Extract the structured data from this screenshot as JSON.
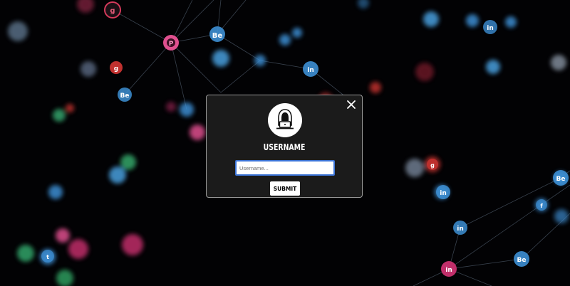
{
  "login": {
    "title": "USERNAME",
    "input_placeholder": "Username...",
    "input_value": "",
    "submit_label": "SUBMIT",
    "close_icon": "close-icon",
    "avatar_icon": "hacker-laptop-icon"
  },
  "background": {
    "description_icons": [
      "behance-icon",
      "linkedin-icon",
      "twitter-icon",
      "google-plus-icon",
      "pinterest-icon",
      "facebook-icon"
    ],
    "colors": {
      "bg": "#020204",
      "pink": "#e0508f",
      "blue": "#3d8fd4",
      "red": "#c0312f",
      "green": "#33a86a"
    }
  }
}
